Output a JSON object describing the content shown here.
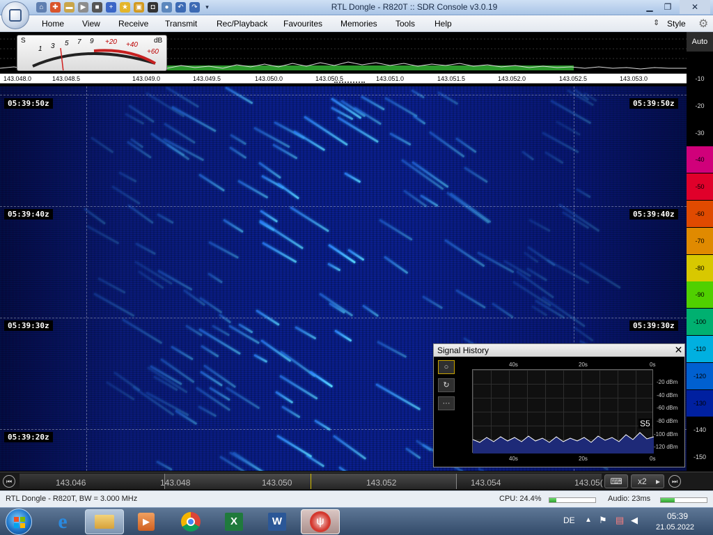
{
  "window": {
    "title": "RTL Dongle - R820T :: SDR Console v3.0.19"
  },
  "menu": {
    "items": [
      "Home",
      "View",
      "Receive",
      "Transmit",
      "Rec/Playback",
      "Favourites",
      "Memories",
      "Tools",
      "Help"
    ],
    "style_label": "Style"
  },
  "scale": {
    "auto_label": "Auto",
    "ticks": [
      "-10",
      "-20",
      "-30",
      "-40",
      "-50",
      "-60",
      "-70",
      "-80",
      "-90",
      "-100",
      "-110",
      "-120",
      "-130",
      "-140",
      "-150"
    ],
    "tick_colors": [
      "#000000",
      "#000000",
      "#000000",
      "#d0007a",
      "#e0002a",
      "#e04a00",
      "#e08a00",
      "#d8c800",
      "#50d000",
      "#00b070",
      "#00b0e0",
      "#0060d0",
      "#0020a0",
      "#000000",
      "#000000"
    ]
  },
  "smeter": {
    "s_label": "S",
    "db_label": "dB",
    "scale_left": [
      "1",
      "3",
      "5",
      "7",
      "9"
    ],
    "scale_right": [
      "+20",
      "+40",
      "+60"
    ]
  },
  "spectrum": {
    "freq_labels": [
      "143.048.0",
      "143.048.5",
      "143.049.0",
      "143.049.5",
      "143.050.0",
      "143.050.5",
      "143.051.0",
      "143.051.5",
      "143.052.0",
      "143.052.5",
      "143.053.0"
    ]
  },
  "waterfall": {
    "timestamps": [
      "05:39:50z",
      "05:39:40z",
      "05:39:30z",
      "05:39:20z"
    ]
  },
  "signal_history": {
    "title": "Signal History",
    "close": "✕",
    "tools": [
      "○",
      "↻",
      "···"
    ],
    "top_axis": [
      "40s",
      "20s",
      "0s"
    ],
    "bottom_axis": [
      "40s",
      "20s",
      "0s"
    ],
    "y_labels": [
      "-20 dBm",
      "-40 dBm",
      "-60 dBm",
      "-80 dBm",
      "-100 dBm",
      "-120 dBm"
    ],
    "s_reading": "S5"
  },
  "tuning": {
    "labels": [
      "143.046",
      "143.048",
      "143.050",
      "143.052",
      "143.054",
      "143.05("
    ],
    "zoom": "x2",
    "keyboard_icon": "keyboard-icon"
  },
  "status": {
    "left": "RTL Dongle - R820T, BW = 3.000 MHz",
    "cpu": "CPU: 24.4%",
    "cpu_level": 0.15,
    "audio": "Audio: 23ms",
    "audio_level": 0.3
  },
  "taskbar": {
    "lang": "DE",
    "time": "05:39",
    "date": "21.05.2022"
  }
}
